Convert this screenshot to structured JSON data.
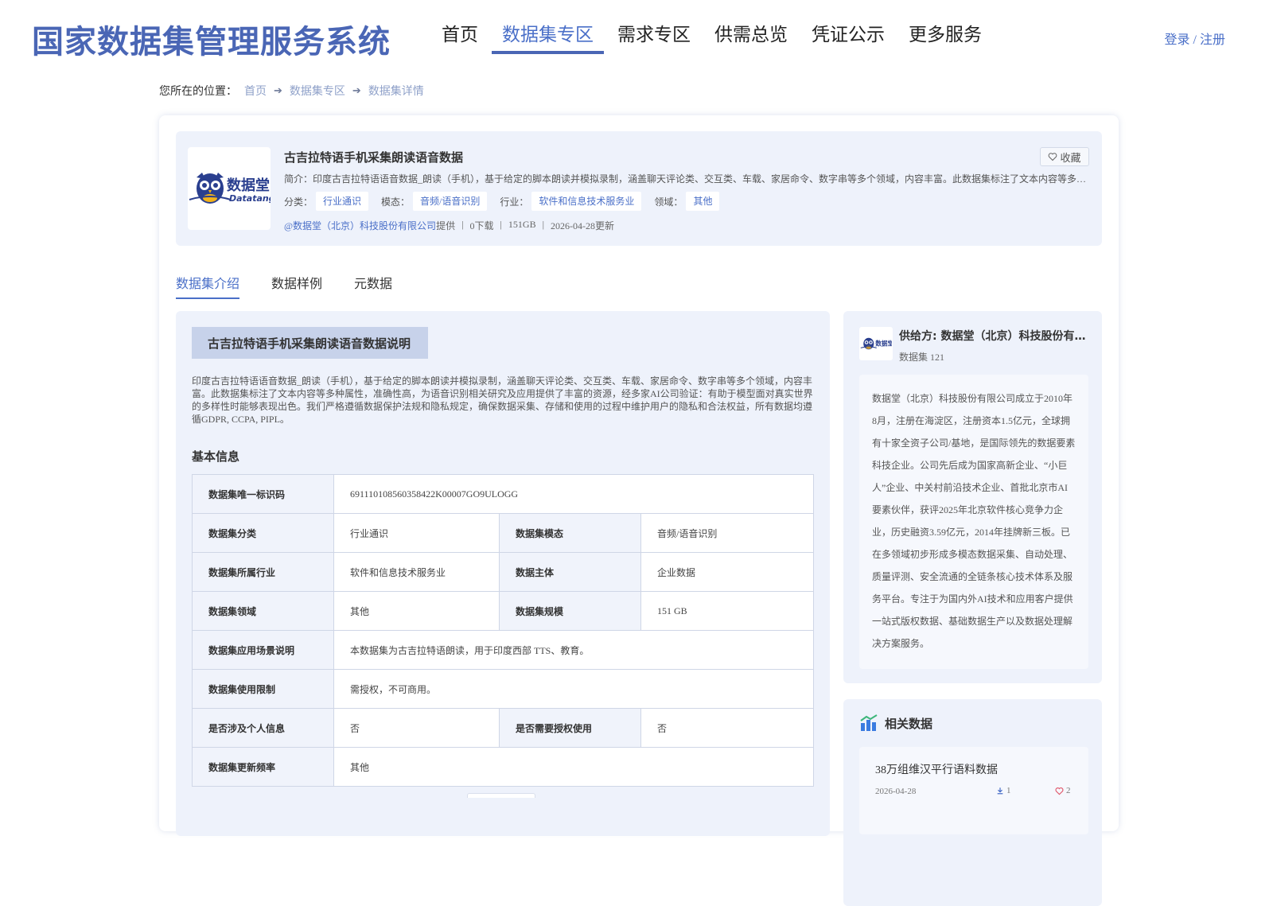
{
  "header": {
    "site_title": "国家数据集管理服务系统",
    "nav": [
      "首页",
      "数据集专区",
      "需求专区",
      "供需总览",
      "凭证公示",
      "更多服务"
    ],
    "login": "登录 / 注册"
  },
  "breadcrumb": {
    "prefix": "您所在的位置：",
    "items": [
      "首页",
      "数据集专区",
      "数据集详情"
    ]
  },
  "dataset": {
    "logo_text": "数据堂",
    "logo_subtext": "Datatang",
    "title": "古吉拉特语手机采集朗读语音数据",
    "favorite": "收藏",
    "intro": "简介：印度古吉拉特语语音数据_朗读（手机），基于给定的脚本朗读并模拟录制，涵盖聊天评论类、交互类、车载、家居命令、数字串等多个领域，内容丰富。此数据集标注了文本内容等多种属性，准确性高，为语音识别相关研究及应用提供了丰富的资源，经多家AI公司验证：有助于模型面对真实世界的多样性时能够表现出色。",
    "tags": [
      {
        "label": "分类：",
        "value": "行业通识"
      },
      {
        "label": "模态：",
        "value": "音频/语音识别"
      },
      {
        "label": "行业：",
        "value": "软件和信息技术服务业"
      },
      {
        "label": "领域：",
        "value": "其他"
      }
    ],
    "provider": "@数据堂（北京）科技股份有限公司",
    "provider_suffix": "提供",
    "sep": "|",
    "downloads": "0下载",
    "size": "151GB",
    "updated": "2026-04-28更新"
  },
  "tabs": [
    "数据集介绍",
    "数据样例",
    "元数据"
  ],
  "intro_section": {
    "title": "古吉拉特语手机采集朗读语音数据说明",
    "description": "印度古吉拉特语语音数据_朗读（手机），基于给定的脚本朗读并模拟录制，涵盖聊天评论类、交互类、车载、家居命令、数字串等多个领域，内容丰富。此数据集标注了文本内容等多种属性，准确性高，为语音识别相关研究及应用提供了丰富的资源，经多家AI公司验证：有助于模型面对真实世界的多样性时能够表现出色。我们严格遵循数据保护法规和隐私规定，确保数据采集、存储和使用的过程中维护用户的隐私和合法权益，所有数据均遵循GDPR, CCPA, PIPL。",
    "basic_title": "基本信息"
  },
  "basic_info": {
    "id_key": "数据集唯一标识码",
    "id_val": "691110108560358422K00007GO9ULOGG",
    "cat_key": "数据集分类",
    "cat_val": "行业通识",
    "modal_key": "数据集模态",
    "modal_val": "音频/语音识别",
    "ind_key": "数据集所属行业",
    "ind_val": "软件和信息技术服务业",
    "subject_key": "数据主体",
    "subject_val": "企业数据",
    "field_key": "数据集领域",
    "field_val": "其他",
    "scale_key": "数据集规模",
    "scale_val": "151 GB",
    "scene_key": "数据集应用场景说明",
    "scene_val": "本数据集为古吉拉特语朗读，用于印度西部 TTS、教育。",
    "limit_key": "数据集使用限制",
    "limit_val": "需授权，不可商用。",
    "personal_key": "是否涉及个人信息",
    "personal_val": "否",
    "auth_key": "是否需要授权使用",
    "auth_val": "否",
    "freq_key": "数据集更新频率",
    "freq_val": "其他"
  },
  "provider_card": {
    "name": "供给方: 数据堂（北京）科技股份有限公司",
    "count": "数据集 121",
    "description": "数据堂（北京）科技股份有限公司成立于2010年8月，注册在海淀区，注册资本1.5亿元，全球拥有十家全资子公司/基地，是国际领先的数据要素科技企业。公司先后成为国家高新企业、“小巨人”企业、中关村前沿技术企业、首批北京市AI要素伙伴，获评2025年北京软件核心竞争力企业，历史融资3.59亿元，2014年挂牌新三板。已在多领域初步形成多模态数据采集、自动处理、质量评测、安全流通的全链条核心技术体系及服务平台。专注于为国内外AI技术和应用客户提供一站式版权数据、基础数据生产以及数据处理解决方案服务。"
  },
  "related": {
    "title": "相关数据",
    "items": [
      {
        "title": "38万组维汉平行语料数据",
        "date": "2026-04-28",
        "downloads": "1",
        "likes": "2"
      }
    ]
  },
  "colors": {
    "brand": "#4a66b5",
    "accent": "#4a6fc8",
    "panel_bg": "#eef2fb"
  }
}
